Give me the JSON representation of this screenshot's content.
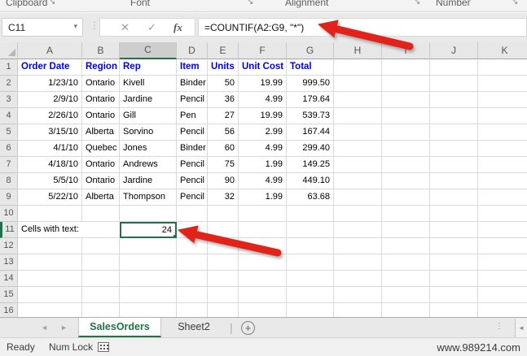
{
  "ribbon": {
    "groups": [
      {
        "label": "Clipboard"
      },
      {
        "label": "Font"
      },
      {
        "label": "Alignment"
      },
      {
        "label": "Number"
      }
    ]
  },
  "formula_bar": {
    "name_box_value": "C11",
    "cancel_label": "✕",
    "enter_label": "✓",
    "fx_label": "fx",
    "formula": "=COUNTIF(A2:G9, \"*\")"
  },
  "sheet": {
    "column_letters": [
      "A",
      "B",
      "C",
      "D",
      "E",
      "F",
      "G",
      "H",
      "I",
      "J",
      "K"
    ],
    "row_numbers": [
      "1",
      "2",
      "3",
      "4",
      "5",
      "6",
      "7",
      "8",
      "9",
      "10",
      "11",
      "12",
      "13",
      "14",
      "15",
      "16"
    ],
    "selected_cell_ref": "C11",
    "selected_column": "C",
    "selected_row": "11",
    "header_row": [
      "Order Date",
      "Region",
      "Rep",
      "Item",
      "Units",
      "Unit Cost",
      "Total"
    ],
    "data_rows": [
      [
        "1/23/10",
        "Ontario",
        "Kivell",
        "Binder",
        "50",
        "19.99",
        "999.50"
      ],
      [
        "2/9/10",
        "Ontario",
        "Jardine",
        "Pencil",
        "36",
        "4.99",
        "179.64"
      ],
      [
        "2/26/10",
        "Ontario",
        "Gill",
        "Pen",
        "27",
        "19.99",
        "539.73"
      ],
      [
        "3/15/10",
        "Alberta",
        "Sorvino",
        "Pencil",
        "56",
        "2.99",
        "167.44"
      ],
      [
        "4/1/10",
        "Quebec",
        "Jones",
        "Binder",
        "60",
        "4.99",
        "299.40"
      ],
      [
        "4/18/10",
        "Ontario",
        "Andrews",
        "Pencil",
        "75",
        "1.99",
        "149.25"
      ],
      [
        "5/5/10",
        "Ontario",
        "Jardine",
        "Pencil",
        "90",
        "4.99",
        "449.10"
      ],
      [
        "5/22/10",
        "Alberta",
        "Thompson",
        "Pencil",
        "32",
        "1.99",
        "63.68"
      ]
    ],
    "summary": {
      "label": "Cells with text:",
      "value": "24"
    }
  },
  "tabs": {
    "items": [
      {
        "label": "SalesOrders",
        "active": true
      },
      {
        "label": "Sheet2",
        "active": false
      }
    ],
    "add_label": "+"
  },
  "status_bar": {
    "mode": "Ready",
    "keyboard": "Num Lock",
    "watermark": "www.989214.com"
  },
  "icons": {
    "dialog_launcher": "↘",
    "name_box_dropdown": "▾",
    "tab_nav_left": "◄",
    "tab_nav_right": "►",
    "tab_grip_dots": "⋮",
    "hscroll_left": "◄",
    "formula_grip_dots": "⋮"
  },
  "colors": {
    "excel_green": "#217346",
    "header_text_blue": "#0000ee",
    "arrow_red": "#e2231a"
  }
}
